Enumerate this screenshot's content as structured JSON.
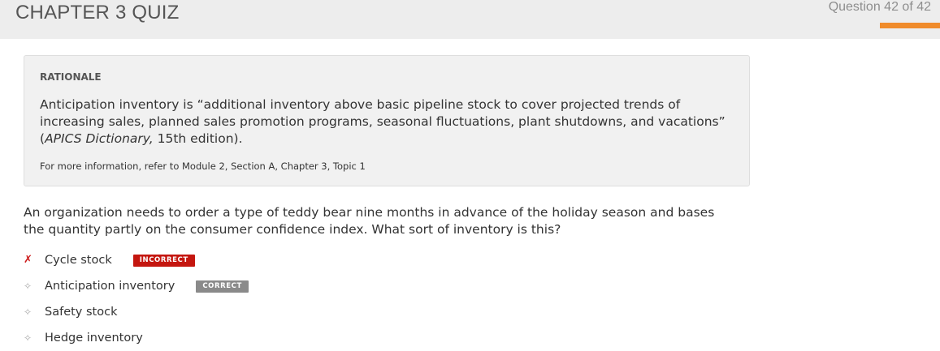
{
  "header": {
    "title": "CHAPTER 3 QUIZ",
    "question_counter": "Question 42 of 42",
    "progress_fraction": 1.0,
    "accent_color": "#f08b2a"
  },
  "rationale": {
    "label": "RATIONALE",
    "text_before": "Anticipation inventory is “additional inventory above basic pipeline stock to cover projected trends of increasing sales, planned sales promotion programs, seasonal fluctuations, plant shutdowns, and vacations” (",
    "text_italic": "APICS Dictionary,",
    "text_after": " 15th edition).",
    "reference": "For more information, refer to Module 2, Section A, Chapter 3, Topic 1"
  },
  "question": {
    "text": "An organization needs to order a type of teddy bear nine months in advance of the holiday season and bases the quantity partly on the consumer confidence index. What sort of inventory is this?"
  },
  "options": [
    {
      "mark": "✗",
      "mark_icon": "x-mark-icon",
      "label": "Cycle stock",
      "badge": "INCORRECT",
      "badge_color": "#c4160f"
    },
    {
      "mark": "✧",
      "mark_icon": "diamond-bullet-icon",
      "label": "Anticipation inventory",
      "badge": "CORRECT",
      "badge_color": "#8a8a8a"
    },
    {
      "mark": "✧",
      "mark_icon": "diamond-bullet-icon",
      "label": "Safety stock",
      "badge": ""
    },
    {
      "mark": "✧",
      "mark_icon": "diamond-bullet-icon",
      "label": "Hedge inventory",
      "badge": ""
    }
  ]
}
